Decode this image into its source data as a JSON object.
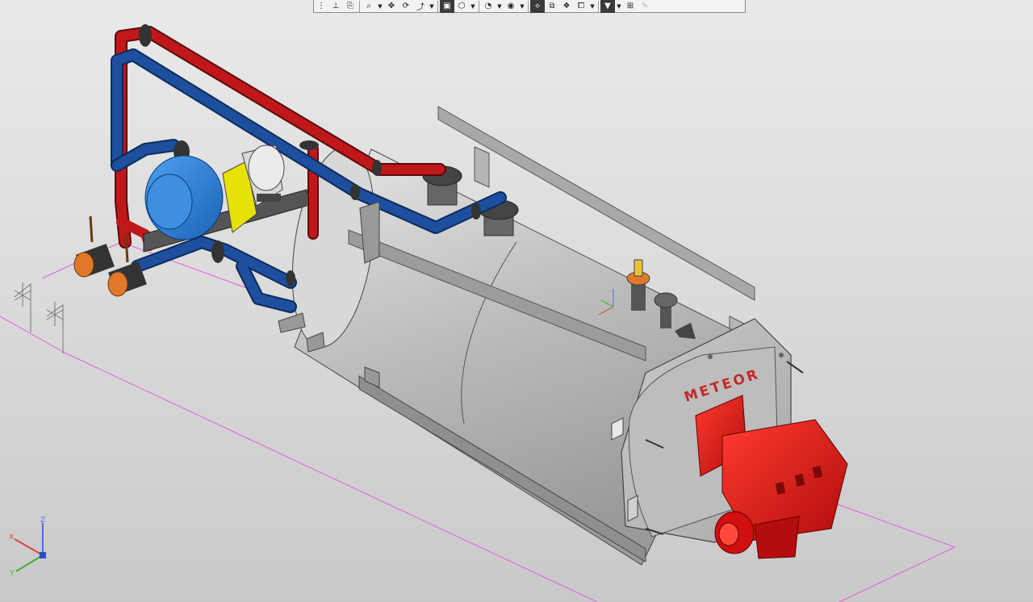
{
  "toolbar": {
    "groups": [
      [
        {
          "icon": "select-filter-icon",
          "glyph": "⋮"
        },
        {
          "icon": "local-cs-icon",
          "glyph": "⊥"
        },
        {
          "icon": "view-orientation-icon",
          "glyph": "⎘"
        }
      ],
      [
        {
          "icon": "zoom-window-icon",
          "glyph": "⌕",
          "arrow": true
        },
        {
          "icon": "pan-icon",
          "glyph": "✥"
        },
        {
          "icon": "rotate-icon",
          "glyph": "⟳"
        },
        {
          "icon": "orbit-icon",
          "glyph": "⤴",
          "arrow": true
        }
      ],
      [
        {
          "icon": "view-cube-icon",
          "glyph": "▣",
          "active": true
        },
        {
          "icon": "isometric-view-icon",
          "glyph": "⬡",
          "arrow": true
        }
      ],
      [
        {
          "icon": "display-mode-icon",
          "glyph": "◔",
          "arrow": true
        },
        {
          "icon": "shading-icon",
          "glyph": "◉",
          "arrow": true
        }
      ],
      [
        {
          "icon": "perspective-icon",
          "glyph": "⟡",
          "active": true
        },
        {
          "icon": "section-icon",
          "glyph": "⧉"
        },
        {
          "icon": "hide-components-icon",
          "glyph": "❖"
        },
        {
          "icon": "layers-icon",
          "glyph": "⧠",
          "arrow": true
        }
      ],
      [
        {
          "icon": "filter-icon",
          "glyph": "▼",
          "active": true,
          "arrow": true
        },
        {
          "icon": "measure-icon",
          "glyph": "⊞"
        },
        {
          "icon": "edit-pen-icon",
          "glyph": "✎",
          "disabled": true
        }
      ]
    ]
  },
  "scene": {
    "brand_label": "METEOR",
    "colors": {
      "hot_pipe": "#c0171b",
      "cold_pipe": "#1d4f9e",
      "shell": "#c8c8c8",
      "burner": "#e01010",
      "pump": "#2a7fd8",
      "coupling": "#e8e20a",
      "valve": "#e0782a",
      "construction_line": "#e060e0"
    }
  },
  "triad": {
    "x": "X",
    "y": "Y",
    "z": "Z"
  }
}
